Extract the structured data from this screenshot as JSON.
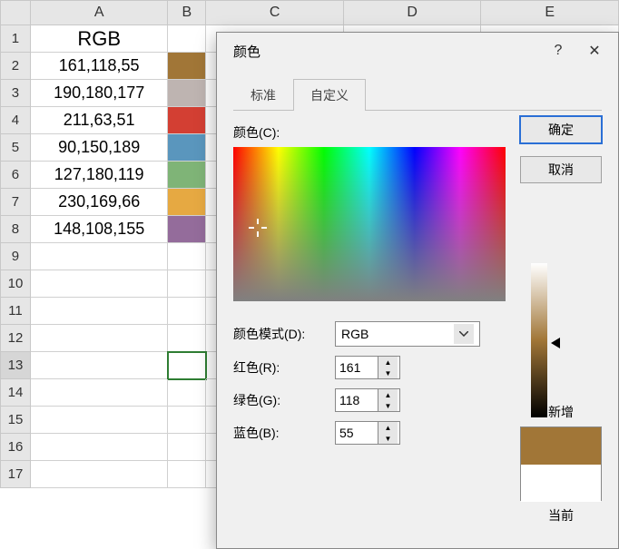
{
  "columns": [
    "A",
    "B",
    "C",
    "D",
    "E"
  ],
  "rows": {
    "count": 17,
    "selected": 13
  },
  "header_cell": "RGB",
  "data": [
    {
      "rgb": "161,118,55",
      "color": "#a17637"
    },
    {
      "rgb": "190,180,177",
      "color": "#beb4b1"
    },
    {
      "rgb": "211,63,51",
      "color": "#d33f33"
    },
    {
      "rgb": "90,150,189",
      "color": "#5a96bd"
    },
    {
      "rgb": "127,180,119",
      "color": "#7fb477"
    },
    {
      "rgb": "230,169,66",
      "color": "#e6a942"
    },
    {
      "rgb": "148,108,155",
      "color": "#946c9b"
    }
  ],
  "dialog": {
    "title": "颜色",
    "help": "?",
    "close": "✕",
    "tabs": {
      "standard": "标准",
      "custom": "自定义"
    },
    "ok": "确定",
    "cancel": "取消",
    "color_label": "颜色(C):",
    "mode_label": "颜色模式(D):",
    "mode_value": "RGB",
    "red_label": "红色(R):",
    "green_label": "绿色(G):",
    "blue_label": "蓝色(B):",
    "red": "161",
    "green": "118",
    "blue": "55",
    "new_label": "新增",
    "current_label": "当前"
  }
}
